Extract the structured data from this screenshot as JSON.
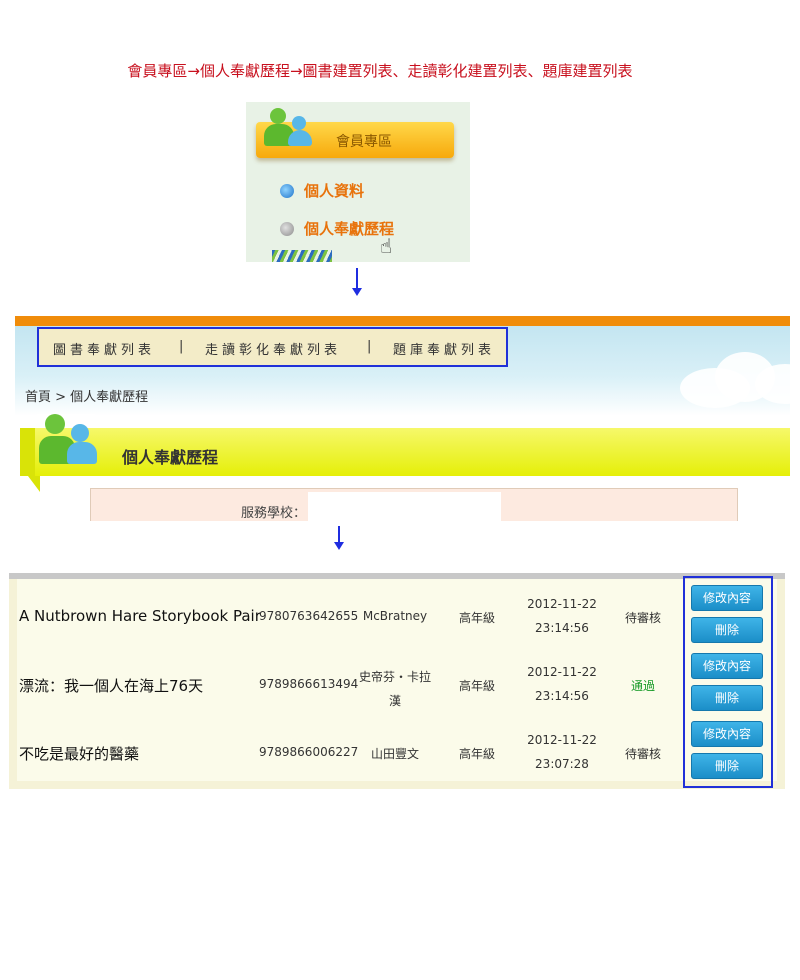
{
  "caption": "會員專區→個人奉獻歷程→圖書建置列表、走讀彰化建置列表、題庫建置列表",
  "member_menu": {
    "header": "會員專區",
    "items": [
      "個人資料",
      "個人奉獻歷程"
    ]
  },
  "nav": {
    "tabs": [
      "圖書奉獻列表",
      "走讀彰化奉獻列表",
      "題庫奉獻列表"
    ],
    "separator": "|"
  },
  "breadcrumb": "首頁 > 個人奉獻歷程",
  "page_title": "個人奉獻歷程",
  "form": {
    "school_label": "服務學校："
  },
  "table": {
    "rows": [
      {
        "title": "A Nutbrown Hare Storybook Pair",
        "isbn": "9780763642655",
        "author": "McBratney",
        "grade": "高年級",
        "date": "2012-11-22",
        "time": "23:14:56",
        "status": "待審核"
      },
      {
        "title": "漂流：我一個人在海上76天",
        "isbn": "9789866613494",
        "author": "史帝芬・卡拉漢",
        "grade": "高年級",
        "date": "2012-11-22",
        "time": "23:14:56",
        "status": "通過"
      },
      {
        "title": "不吃是最好的醫藥",
        "isbn": "9789866006227",
        "author": "山田豐文",
        "grade": "高年級",
        "date": "2012-11-22",
        "time": "23:07:28",
        "status": "待審核"
      }
    ],
    "edit_label": "修改內容",
    "delete_label": "刪除"
  },
  "colors": {
    "caption": "#c8101e",
    "accent_orange": "#f08c0a",
    "highlight_box": "#2030d8",
    "pass": "#1a9c2a"
  }
}
